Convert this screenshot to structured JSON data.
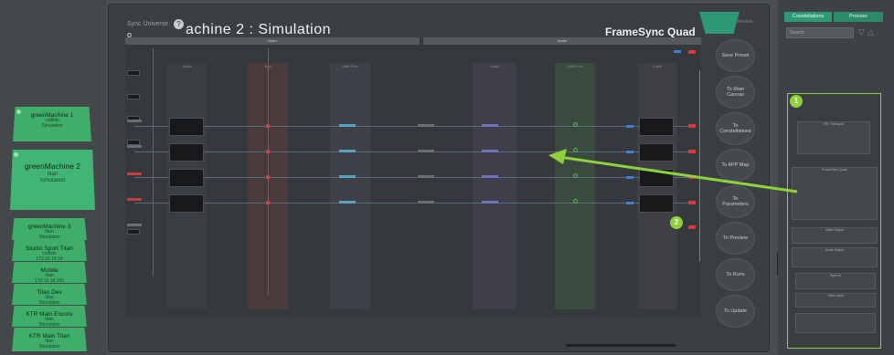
{
  "left_cards": [
    {
      "title": "greenMachine 1",
      "line2": "callisto",
      "line3": "Simulation"
    },
    {
      "title": "greenMachine 2",
      "line2": "titan",
      "line3": "Simulation"
    },
    {
      "title": "greenMachine 3",
      "line2": "titan",
      "line3": "Simulation"
    },
    {
      "title": "Studio Sport Titan",
      "line2": "callisto",
      "line3": "172.16.18.14"
    },
    {
      "title": "Mobile",
      "line2": "titan",
      "line3": "172.16.18.190"
    },
    {
      "title": "Titan Dev",
      "line2": "titan",
      "line3": "Simulation"
    },
    {
      "title": "KTR Main Encore",
      "line2": "titan",
      "line3": "Simulation"
    },
    {
      "title": "KTR Main Titan",
      "line2": "titan",
      "line3": "Simulation"
    }
  ],
  "header": {
    "sync_label": "Sync Universe",
    "o_label": "o",
    "title": "achine 2  :  Simulation",
    "device": "FrameSync Quad",
    "review_label": "Review"
  },
  "canvas": {
    "top_sections": [
      "Video",
      "Audio"
    ],
    "columns": [
      "Inputs",
      "Sync",
      "Video Proc",
      "Audio",
      "Audio Proc",
      "Output"
    ],
    "row_tags": [
      "FS1",
      "FS2",
      "FS3",
      "FS4"
    ]
  },
  "side_buttons": [
    {
      "label": "Save Preset"
    },
    {
      "label": "To Main Canvas"
    },
    {
      "label": "To Constellations"
    },
    {
      "label": "To APP Map"
    },
    {
      "label": "To Parameters"
    },
    {
      "label": "To Preview"
    },
    {
      "label": "To Runs"
    },
    {
      "label": "To Update"
    }
  ],
  "right_panel": {
    "tabs": [
      "Constellations",
      "Process"
    ],
    "search_placeholder": "Search",
    "badge1": "1",
    "badge2": "2",
    "sections": [
      "FS1 Transport",
      "FrameSync Quad",
      "Video Output",
      "Audio Output",
      "Sync In",
      "Video Input"
    ]
  },
  "colors": {
    "accent_green": "#8ed13c",
    "card_green": "#3fae6a",
    "tab_green": "#2e9a75",
    "connector_blue": "#3f7fd6",
    "connector_red": "#d63a3a"
  },
  "icons": [
    "help-icon",
    "filter-icon",
    "warning-icon",
    "annotation-arrow"
  ]
}
